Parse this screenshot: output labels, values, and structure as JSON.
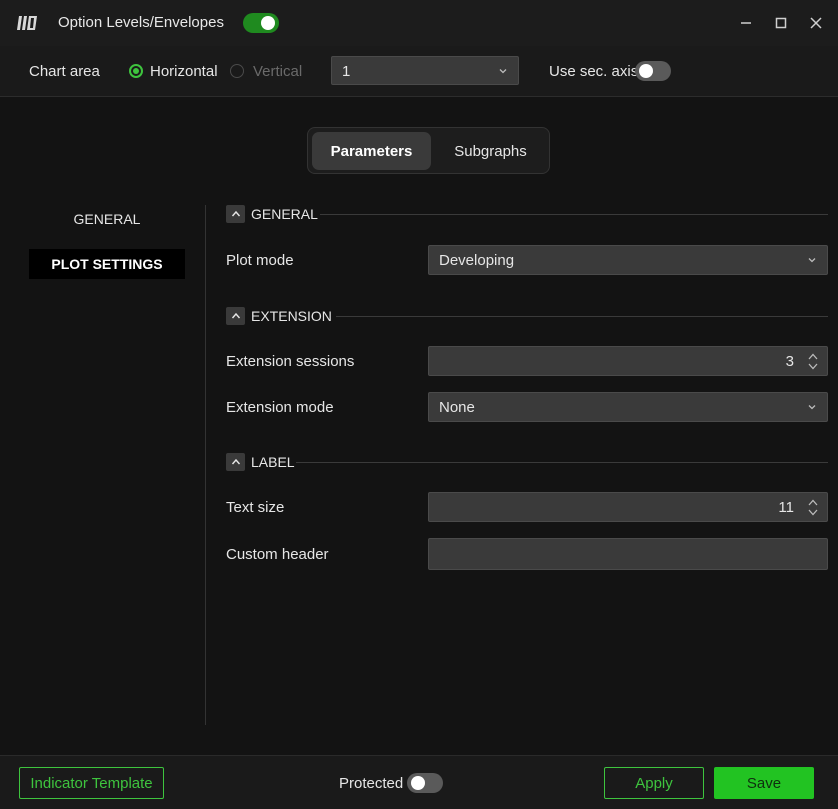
{
  "window": {
    "title": "Option Levels/Envelopes",
    "enabled": true
  },
  "chart_area": {
    "label": "Chart area",
    "orientation_horizontal": "Horizontal",
    "orientation_vertical": "Vertical",
    "selected_orientation": "Horizontal",
    "chart_select_value": "1",
    "sec_axis_label": "Use sec. axis",
    "sec_axis_enabled": false
  },
  "tabs": [
    {
      "label": "Parameters",
      "active": true
    },
    {
      "label": "Subgraphs",
      "active": false
    }
  ],
  "nav": {
    "general": "GENERAL",
    "plot_settings": "PLOT SETTINGS",
    "active": "PLOT SETTINGS"
  },
  "sections": {
    "general": {
      "title": "GENERAL",
      "plot_mode_label": "Plot mode",
      "plot_mode_value": "Developing"
    },
    "extension": {
      "title": "EXTENSION",
      "sessions_label": "Extension sessions",
      "sessions_value": "3",
      "mode_label": "Extension mode",
      "mode_value": "None"
    },
    "label": {
      "title": "LABEL",
      "text_size_label": "Text size",
      "text_size_value": "11",
      "custom_header_label": "Custom header",
      "custom_header_value": ""
    }
  },
  "footer": {
    "template_button": "Indicator Template",
    "protected_label": "Protected",
    "protected_enabled": false,
    "apply_button": "Apply",
    "save_button": "Save"
  },
  "colors": {
    "accent": "#3ec43e",
    "save_bg": "#22c322",
    "background": "#131313",
    "control_bg": "#3a3a3a"
  }
}
